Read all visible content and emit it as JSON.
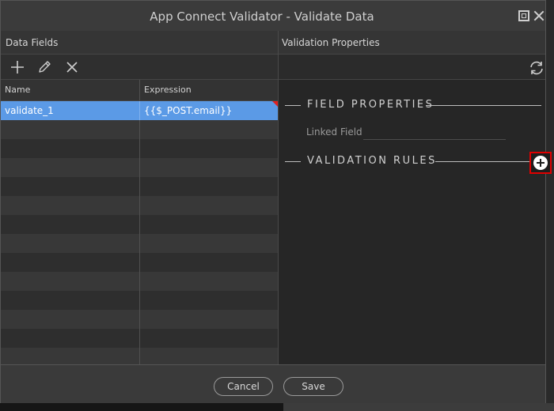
{
  "window": {
    "title": "App Connect Validator - Validate Data"
  },
  "left_pane": {
    "header": "Data Fields",
    "toolbar": {
      "add_icon": "plus-icon",
      "edit_icon": "pencil-icon",
      "delete_icon": "x-icon"
    },
    "columns": [
      "Name",
      "Expression"
    ],
    "rows": [
      {
        "name": "validate_1",
        "expression": "{{$_POST.email}}"
      }
    ]
  },
  "right_pane": {
    "header": "Validation Properties",
    "refresh_icon": "refresh-icon",
    "field_properties_title": "FIELD PROPERTIES",
    "linked_field_label": "Linked Field",
    "linked_field_value": "",
    "validation_rules_title": "VALIDATION RULES",
    "add_rule_icon": "plus-circle-icon"
  },
  "footer": {
    "cancel_label": "Cancel",
    "save_label": "Save"
  },
  "colors": {
    "selection": "#5b9ae6",
    "highlight_border": "#e00000"
  }
}
